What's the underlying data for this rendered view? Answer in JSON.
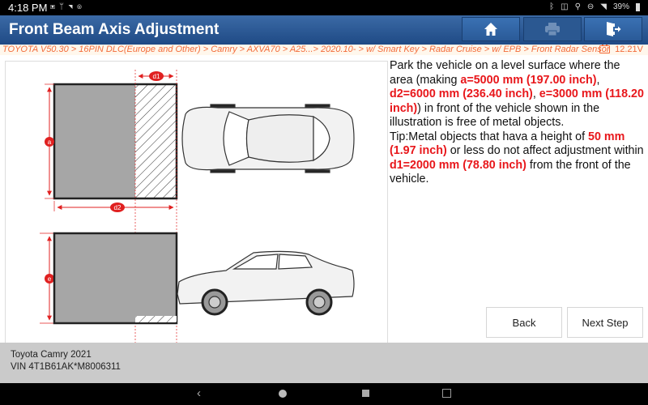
{
  "status_bar": {
    "time": "4:18 PM",
    "left_icons": [
      "image-icon",
      "usb-icon",
      "wifi-off-icon",
      "settings-icon"
    ],
    "battery_percent": "39%",
    "right_icons": [
      "bluetooth-icon",
      "vibrate-icon",
      "location-icon",
      "dnd-icon",
      "wifi-icon"
    ]
  },
  "header": {
    "title": "Front Beam Axis Adjustment",
    "buttons": [
      {
        "name": "home",
        "icon": "home-icon",
        "enabled": true
      },
      {
        "name": "print",
        "icon": "printer-icon",
        "enabled": false
      },
      {
        "name": "exit",
        "icon": "exit-icon",
        "enabled": true
      }
    ]
  },
  "breadcrumb": {
    "path": "TOYOTA V50.30 > 16PIN DLC(Europe and Other) > Camry > AXVA70 > A25...> 2020.10- > w/ Smart Key > Radar Cruise > w/ EPB > Front Radar Sensor",
    "voltage": "12.21V"
  },
  "diagram": {
    "labels": {
      "a": "a",
      "d1": "d1",
      "d2": "d2",
      "e": "e"
    },
    "colors": {
      "dimension": "#e02020",
      "area": "#a6a6a6"
    }
  },
  "instructions": {
    "p1_a": "Park the vehicle on a level surface where the area (making ",
    "p1_hl1": "a=5000 mm (197.00 inch)",
    "p1_b": ", ",
    "p1_hl2": "d2=6000 mm (236.40 inch)",
    "p1_c": ", ",
    "p1_hl3": "e=3000 mm (118.20 inch)",
    "p1_d": ") in front of the vehicle shown in the illustration is free of metal objects.",
    "p2_a": "Tip:Metal objects that hava a height of ",
    "p2_hl1": "50 mm (1.97 inch)",
    "p2_b": " or less do not affect adjustment within ",
    "p2_hl2": "d1=2000 mm (78.80 inch)",
    "p2_c": " from the front of the vehicle."
  },
  "actions": {
    "back_label": "Back",
    "next_label": "Next Step"
  },
  "footer": {
    "vehicle": "Toyota Camry 2021",
    "vin": "VIN 4T1B61AK*M8006311"
  },
  "nav": [
    "back-icon",
    "home-icon",
    "recents-icon",
    "screenshot-icon"
  ]
}
